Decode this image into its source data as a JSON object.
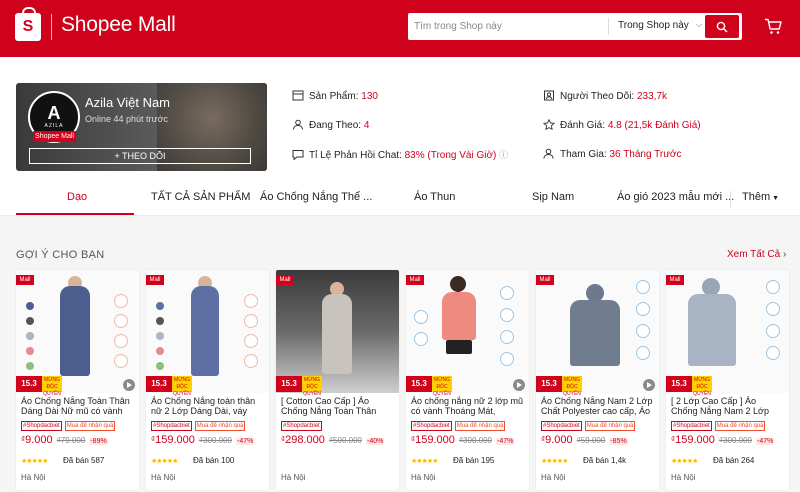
{
  "header": {
    "brand_letter": "S",
    "brand": "Shopee Mall",
    "search_placeholder": "Tìm trong Shop này",
    "search_scope": "Trong Shop này",
    "colors": {
      "primary": "#d0011b"
    }
  },
  "shop": {
    "name": "Azila Việt Nam",
    "avatar_text": "A",
    "avatar_sub": "AZILA",
    "mall_badge": "Shopee Mall",
    "online": "Online 44 phút trước",
    "follow_label": "+ THEO DÕI",
    "stats": {
      "products_label": "Sản Phẩm:",
      "products_value": "130",
      "following_label": "Đang Theo:",
      "following_value": "4",
      "chat_label": "Tỉ Lệ Phản Hồi Chat:",
      "chat_value": "83% (Trong Vài Giờ)",
      "followers_label": "Người Theo Dõi:",
      "followers_value": "233,7k",
      "rating_label": "Đánh Giá:",
      "rating_value": "4.8 (21,5k Đánh Giá)",
      "joined_label": "Tham Gia:",
      "joined_value": "36 Tháng Trước"
    }
  },
  "tabs": [
    "Dạo",
    "TẤT CẢ SẢN PHẨM",
    "Áo Chống Nắng Thể ...",
    "Áo Thun",
    "Sịp Nam",
    "Áo gió 2023 mẫu mới ...",
    "Thêm"
  ],
  "section": {
    "title": "GỢI Ý CHO BẠN",
    "see_all": "Xem Tất Cả"
  },
  "promo": {
    "date": "15.3",
    "label": "MỪNG ĐỘC QUYỀN"
  },
  "products": [
    {
      "mall": "Mall",
      "name": "Áo Chống Nắng Toàn Thân Dáng Dài Nữ mũ có vành cứn...",
      "tag1": "#Shopdacbiet",
      "tag2": "Mua để nhận quà",
      "currency": "₫",
      "price": "9.000",
      "old_price": "₫79.000",
      "discount": "-89%",
      "stars": "★★★★★",
      "sold": "Đã bán 587",
      "location": "Hà Nội"
    },
    {
      "mall": "Mall",
      "name": "Áo Chống Nắng toàn thân nữ 2 Lớp Dáng Dài, váy chống nắn...",
      "tag1": "#Shopdacbiet",
      "tag2": "Mua để nhận quà",
      "currency": "₫",
      "price": "159.000",
      "old_price": "₫300.000",
      "discount": "-47%",
      "stars": "★★★★★",
      "sold": "Đã bán 100",
      "location": "Hà Nội"
    },
    {
      "mall": "Mall",
      "name": "[ Cotton Cao Cấp ] Áo Chống Nắng Toàn Thân Cao Cấp Vải...",
      "tag1": "#Shopdacbiet",
      "tag2": "",
      "currency": "₫",
      "price": "298.000",
      "old_price": "₫500.000",
      "discount": "-40%",
      "stars": "",
      "sold": "",
      "location": "Hà Nội"
    },
    {
      "mall": "Mall",
      "name": "Áo chống nắng nữ 2 lớp mũ có vành Thoáng Mát, Chống Nắn...",
      "tag1": "#Shopdacbiet",
      "tag2": "Mua để nhận quà",
      "currency": "₫",
      "price": "159.000",
      "old_price": "₫300.000",
      "discount": "-47%",
      "stars": "★★★★★",
      "sold": "Đã bán 195",
      "location": "Hà Nội"
    },
    {
      "mall": "Mall",
      "name": "Áo Chống Nắng Nam 2 Lớp Chất Polyester cao cấp, Áo nắ...",
      "tag1": "#Shopdacbiet",
      "tag2": "Mua để nhận quà",
      "currency": "₫",
      "price": "9.000",
      "old_price": "₫59.000",
      "discount": "-85%",
      "stars": "★★★★★",
      "sold": "Đã bán 1,4k",
      "location": "Hà Nội"
    },
    {
      "mall": "Mall",
      "name": "[ 2 Lớp Cao Cấp ] Áo Chống Nắng Nam 2 Lớp Thế Hệ Mới...",
      "tag1": "#Shopdacbiet",
      "tag2": "Mua để nhận quà",
      "currency": "₫",
      "price": "159.000",
      "old_price": "₫300.000",
      "discount": "-47%",
      "stars": "★★★★★",
      "sold": "Đã bán 264",
      "location": "Hà Nội"
    }
  ]
}
